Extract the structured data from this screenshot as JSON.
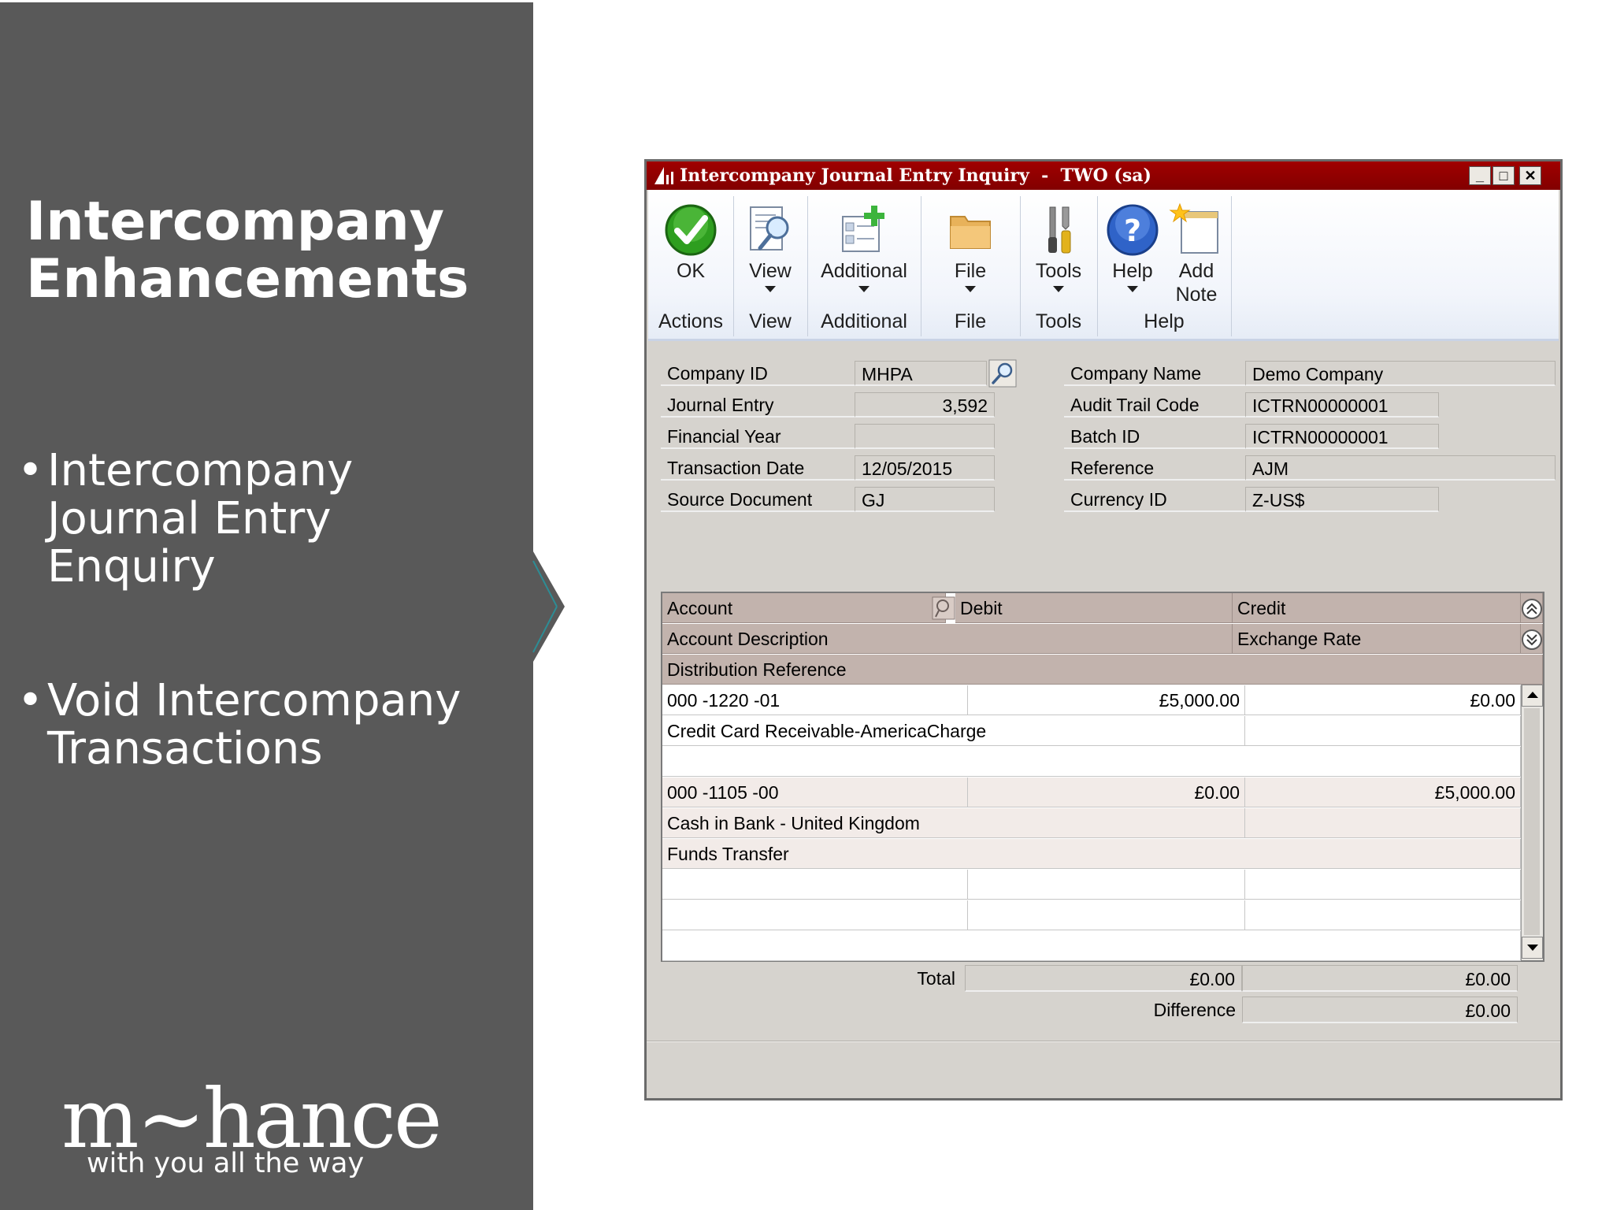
{
  "slide": {
    "title_line1": "Intercompany",
    "title_line2": "Enhancements",
    "bullets": [
      {
        "lines": [
          "Intercompany",
          "Journal Entry",
          "Enquiry"
        ]
      },
      {
        "lines": [
          "Void Intercompany",
          "Transactions"
        ]
      }
    ],
    "bullet_glyph": "•",
    "logo": {
      "mark": "m~hance",
      "tagline": "with you all the way"
    },
    "panel_color": "#595959"
  },
  "window": {
    "title": "Intercompany Journal Entry Inquiry  -  TWO (sa)",
    "title_bar_color": "#8b0000",
    "controls": {
      "minimize": "_",
      "maximize": "□",
      "close": "✕"
    },
    "ribbon": {
      "buttons": [
        {
          "label": "OK",
          "icon": "checkmark-icon"
        },
        {
          "label": "View",
          "icon": "view-magnifier-icon"
        },
        {
          "label": "Additional",
          "icon": "additional-icon"
        },
        {
          "label": "File",
          "icon": "folder-icon"
        },
        {
          "label": "Tools",
          "icon": "tools-icon"
        },
        {
          "label": "Help",
          "icon": "help-icon"
        },
        {
          "label": "Add\nNote",
          "icon": "add-note-icon"
        }
      ],
      "groups": [
        "Actions",
        "View",
        "Additional",
        "File",
        "Tools",
        "Help"
      ]
    },
    "header_left": [
      {
        "label": "Company ID",
        "value": "MHPA"
      },
      {
        "label": "Journal Entry",
        "value": "3,592"
      },
      {
        "label": "Financial Year",
        "value": ""
      },
      {
        "label": "Transaction Date",
        "value": "12/05/2015"
      },
      {
        "label": "Source Document",
        "value": "GJ"
      }
    ],
    "header_right": [
      {
        "label": "Company Name",
        "value": "Demo Company"
      },
      {
        "label": "Audit Trail Code",
        "value": "ICTRN00000001"
      },
      {
        "label": "Batch ID",
        "value": "ICTRN00000001"
      },
      {
        "label": "Reference",
        "value": "AJM"
      },
      {
        "label": "Currency ID",
        "value": "Z-US$"
      }
    ],
    "grid": {
      "headers": {
        "account": "Account",
        "debit": "Debit",
        "credit": "Credit",
        "account_description": "Account Description",
        "exchange_rate": "Exchange Rate",
        "distribution_reference": "Distribution Reference"
      },
      "rows": [
        {
          "account": "000 -1220 -01",
          "debit": "£5,000.00",
          "credit": "£0.00",
          "description": "Credit Card Receivable-AmericaCharge",
          "exchange_rate": "",
          "reference": ""
        },
        {
          "account": "000 -1105 -00",
          "debit": "£0.00",
          "credit": "£5,000.00",
          "description": "Cash in Bank - United Kingdom",
          "exchange_rate": "",
          "reference": "Funds Transfer"
        }
      ]
    },
    "totals": {
      "total_label": "Total",
      "total_debit": "£0.00",
      "total_credit": "£0.00",
      "difference_label": "Difference",
      "difference": "£0.00"
    }
  }
}
